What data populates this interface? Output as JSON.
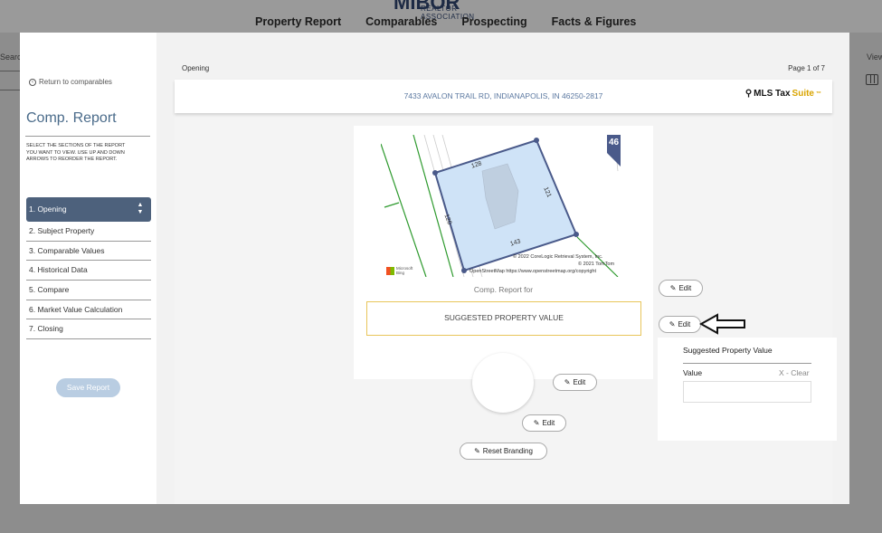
{
  "background": {
    "logo_word": "MIBOR",
    "logo_sub": "REALTOR ASSOCIATION",
    "nav": [
      "Property Report",
      "Comparables",
      "Prospecting",
      "Facts & Figures"
    ],
    "search_label": "Search",
    "view_label": "View"
  },
  "sidebar": {
    "return_label": "Return to comparables",
    "title": "Comp. Report",
    "instructions": "SELECT THE SECTIONS OF THE REPORT YOU WANT TO VIEW. USE UP AND DOWN ARROWS TO REORDER THE REPORT.",
    "sections": [
      {
        "label": "1. Opening",
        "active": true
      },
      {
        "label": "2. Subject Property"
      },
      {
        "label": "3. Comparable Values"
      },
      {
        "label": "4. Historical Data"
      },
      {
        "label": "5. Compare"
      },
      {
        "label": "6. Market Value Calculation"
      },
      {
        "label": "7. Closing"
      }
    ],
    "remove_label": "X",
    "save_label": "Save Report"
  },
  "main": {
    "section_name": "Opening",
    "page_indicator": "Page 1 of 7",
    "address": "7433 AVALON TRAIL RD, INDIANAPOLIS, IN 46250-2817",
    "brand": {
      "prefix": "MLS Tax ",
      "suffix": "Suite",
      "tm": "™"
    },
    "map": {
      "lot_dims": [
        "128",
        "121",
        "143",
        "120"
      ],
      "route_badge": "46",
      "credit_1": "© 2022 CoreLogic Retrieval System, Inc.",
      "credit_2": "© 2021 TomTom",
      "credit_3": "OpenStreetMap https://www.openstreetmap.org/copyright",
      "ms_logo": "Microsoft Bing"
    },
    "comp_report_for": "Comp. Report for",
    "suggested_value_placeholder": "SUGGESTED PROPERTY VALUE",
    "edit_label": "Edit",
    "reset_branding_label": "Reset Branding"
  },
  "panel": {
    "title": "Suggested Property Value",
    "value_label": "Value",
    "clear_label": "X - Clear",
    "value": ""
  },
  "colors": {
    "accent_blue": "#4a6b8a",
    "active_section": "#4d617c",
    "highlight_yellow": "#e8c55a",
    "parcel_fill": "#cfe3f7",
    "parcel_stroke": "#4a5a8a"
  }
}
